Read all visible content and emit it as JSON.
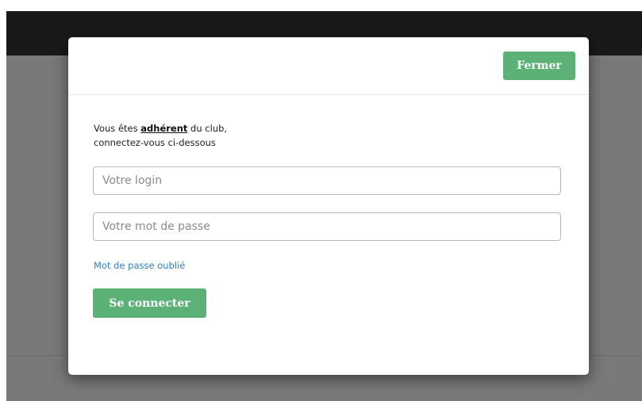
{
  "modal": {
    "close_label": "Fermer",
    "intro": {
      "prefix": "Vous êtes ",
      "emphasis": "adhérent",
      "suffix": " du club,",
      "line2": "connectez-vous ci-dessous"
    },
    "login_placeholder": "Votre login",
    "password_placeholder": "Votre mot de passe",
    "forgot_link": "Mot de passe oublié",
    "submit_label": "Se connecter"
  },
  "colors": {
    "accent_button": "#5cb176",
    "link": "#2f7fc1",
    "overlay": "rgba(0,0,0,0.5)"
  }
}
